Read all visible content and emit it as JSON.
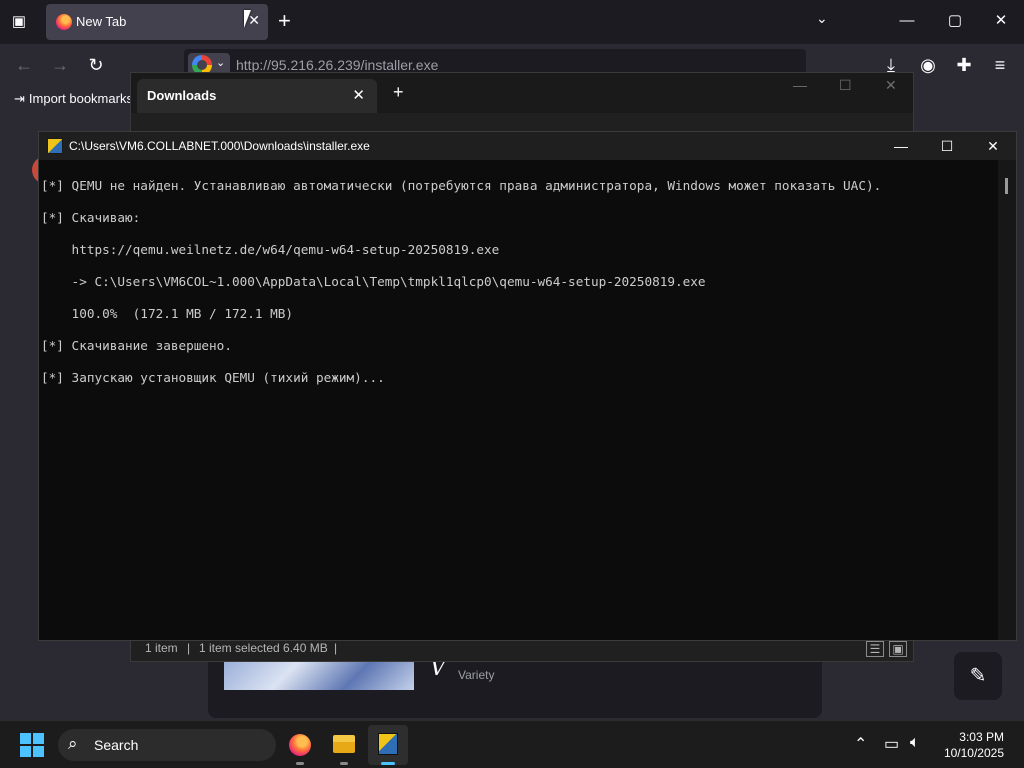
{
  "firefox": {
    "tab_title": "New Tab",
    "tab_close": "✕",
    "new_tab": "+",
    "list_tabs": "⌄",
    "url": "http://95.216.26.239/installer.exe",
    "import_bookmarks": "Import bookmarks",
    "content_card_label": "Variety",
    "content_card_logo": "V",
    "window_controls": {
      "minimize": "—",
      "maximize": "▢",
      "close": "✕"
    }
  },
  "explorer": {
    "tab_title": "Downloads",
    "tab_close": "✕",
    "new_tab": "+",
    "status_items": "1 item",
    "status_selected": "1 item selected  6.40 MB",
    "separator": "|"
  },
  "console": {
    "title": "C:\\Users\\VM6.COLLABNET.000\\Downloads\\installer.exe",
    "lines": [
      "[*] QEMU не найден. Устанавливаю автоматически (потребуются права администратора, Windows может показать UAC).",
      "[*] Скачиваю:",
      "    https://qemu.weilnetz.de/w64/qemu-w64-setup-20250819.exe",
      "    -> C:\\Users\\VM6COL~1.000\\AppData\\Local\\Temp\\tmpkl1qlcp0\\qemu-w64-setup-20250819.exe",
      "    100.0%  (172.1 MB / 172.1 MB)",
      "[*] Скачивание завершено.",
      "[*] Запускаю установщик QEMU (тихий режим)..."
    ],
    "controls": {
      "minimize": "—",
      "maximize": "☐",
      "close": "✕"
    }
  },
  "taskbar": {
    "search_label": "Search",
    "time": "3:03 PM",
    "date": "10/10/2025",
    "accent": "#4cc2ff"
  }
}
